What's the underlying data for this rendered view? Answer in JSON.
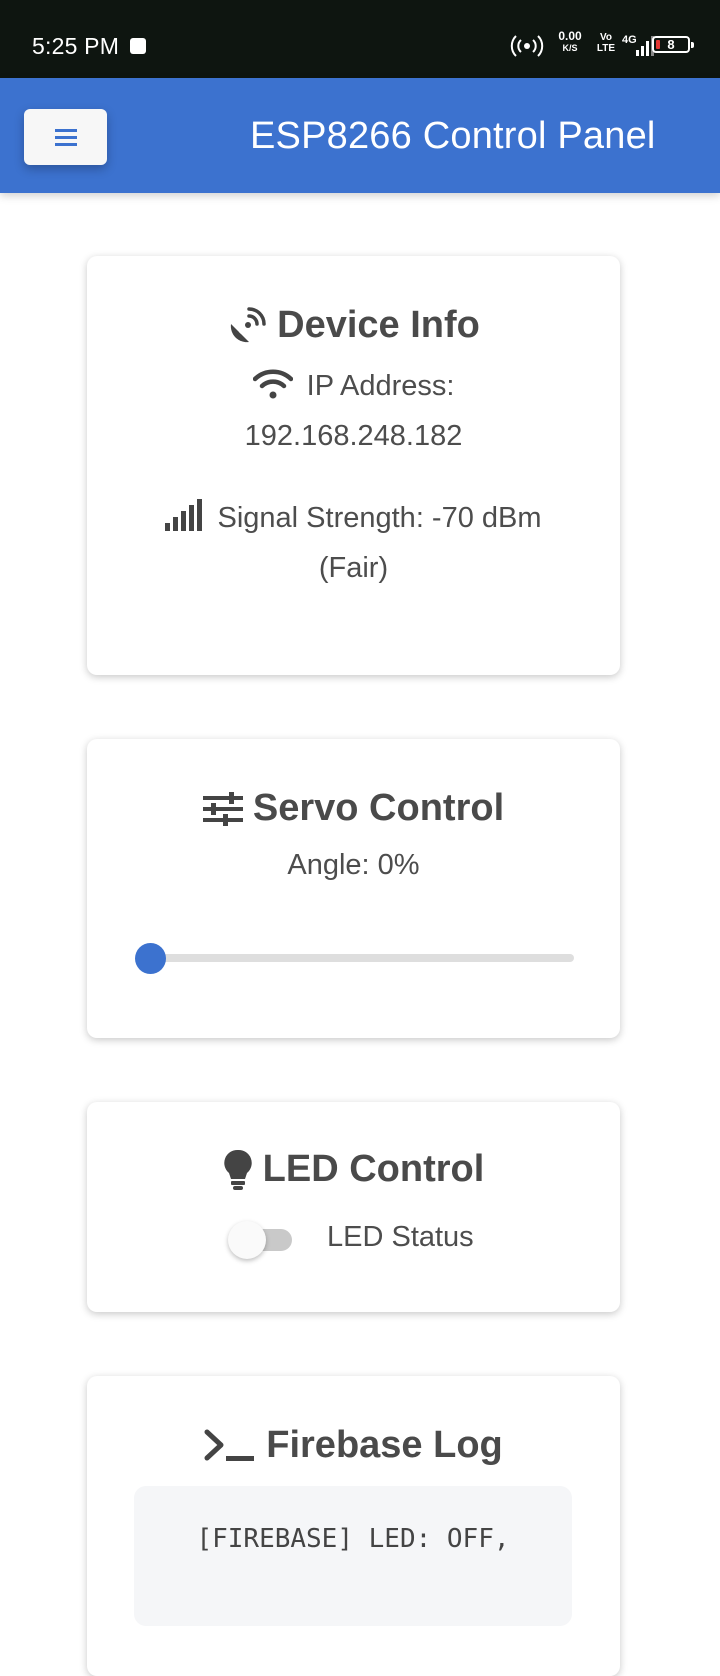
{
  "status_bar": {
    "time": "5:25 PM",
    "net_speed": "0.00",
    "net_speed_unit": "K/S",
    "volte_top": "Vo",
    "volte_bottom": "LTE",
    "network_type": "4G",
    "battery_level": "8",
    "icons": [
      "notification-square-icon",
      "hotspot-icon",
      "signal-icon",
      "battery-icon"
    ]
  },
  "header": {
    "title": "ESP8266 Control Panel",
    "menu_icon": "hamburger-menu-icon"
  },
  "device_info": {
    "title": "Device Info",
    "title_icon": "satellite-dish-icon",
    "ip_label": "IP Address:",
    "ip_value": "192.168.248.182",
    "ip_icon": "wifi-icon",
    "signal_label": "Signal Strength: -70 dBm",
    "signal_quality": "(Fair)",
    "signal_icon": "signal-bars-icon"
  },
  "servo": {
    "title": "Servo Control",
    "title_icon": "sliders-icon",
    "angle_label": "Angle: 0%",
    "value": 0
  },
  "led": {
    "title": "LED Control",
    "title_icon": "lightbulb-icon",
    "status_label": "LED Status",
    "on": false
  },
  "firebase_log": {
    "title": "Firebase Log",
    "title_icon": "terminal-icon",
    "log_line": "[FIREBASE] LED: OFF,"
  },
  "colors": {
    "accent": "#3c72cf",
    "status_bar_bg": "#0e1510",
    "battery_low": "#e53935"
  }
}
